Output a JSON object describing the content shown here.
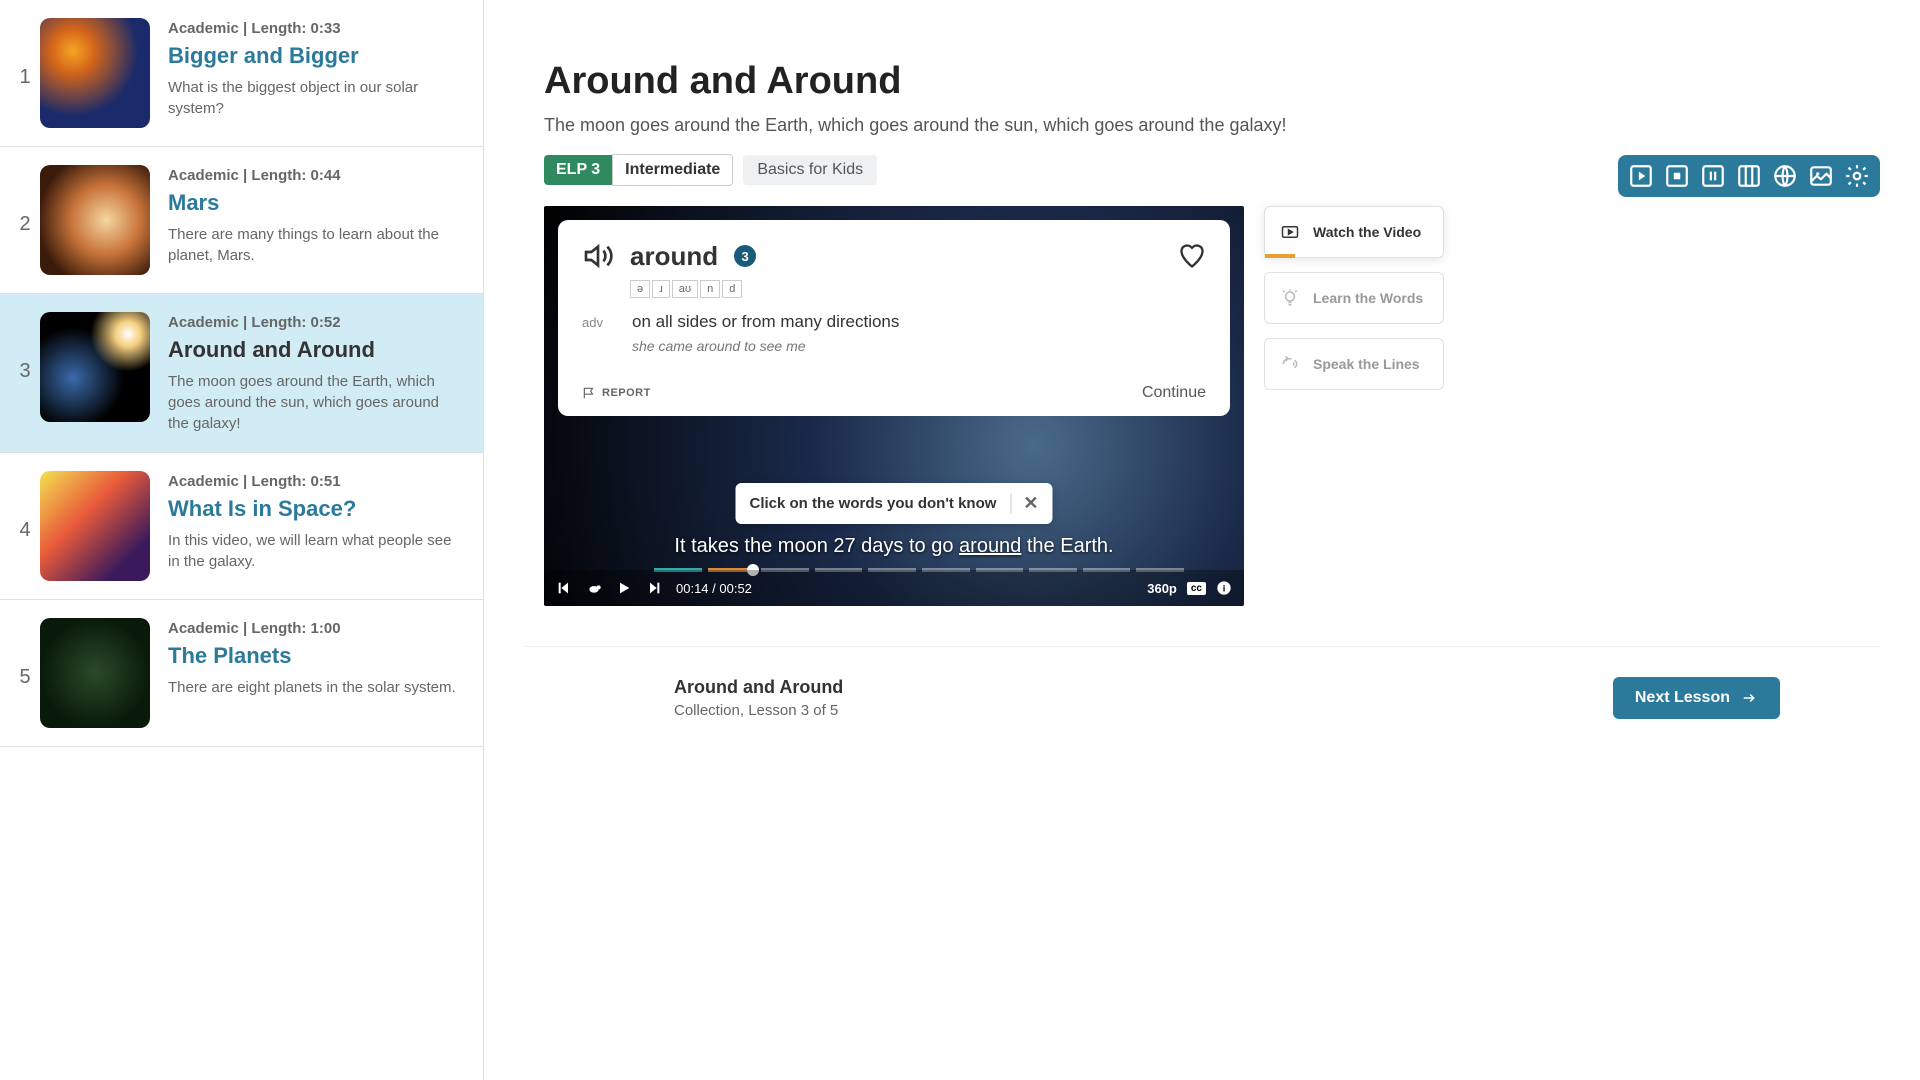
{
  "sidebar": {
    "items": [
      {
        "num": "1",
        "meta": "Academic | Length: 0:33",
        "title": "Bigger and Bigger",
        "desc": "What is the biggest object in our solar system?"
      },
      {
        "num": "2",
        "meta": "Academic | Length: 0:44",
        "title": "Mars",
        "desc": "There are many things to learn about the planet, Mars."
      },
      {
        "num": "3",
        "meta": "Academic | Length: 0:52",
        "title": "Around and Around",
        "desc": "The moon goes around the Earth, which goes around the sun, which goes around the galaxy!"
      },
      {
        "num": "4",
        "meta": "Academic | Length: 0:51",
        "title": "What Is in Space?",
        "desc": "In this video, we will learn what people see in the galaxy."
      },
      {
        "num": "5",
        "meta": "Academic | Length: 1:00",
        "title": "The Planets",
        "desc": "There are eight planets in the solar system."
      }
    ]
  },
  "header": {
    "title": "Around and Around",
    "subtitle": "The moon goes around the Earth, which goes around the sun, which goes around the galaxy!",
    "elp": "ELP 3",
    "level": "Intermediate",
    "category": "Basics for Kids"
  },
  "word_card": {
    "word": "around",
    "badge": "3",
    "phonetics": [
      "ə",
      "ɹ",
      "aʊ",
      "n",
      "d"
    ],
    "pos": "adv",
    "definition": "on all sides or from many directions",
    "example": "she came around to see me",
    "report": "REPORT",
    "continue": "Continue"
  },
  "tooltip": {
    "text": "Click on the words you don't know"
  },
  "caption": {
    "pre": "It  takes  the  moon  27  days  to  go  ",
    "hl": "around",
    "post": "  the Earth."
  },
  "video": {
    "time": "00:14 / 00:52",
    "quality": "360p",
    "cc": "cc"
  },
  "modes": {
    "watch": "Watch the Video",
    "learn": "Learn the Words",
    "speak": "Speak the Lines"
  },
  "footer": {
    "title": "Around and Around",
    "sub": "Collection, Lesson 3 of 5",
    "next": "Next Lesson"
  }
}
